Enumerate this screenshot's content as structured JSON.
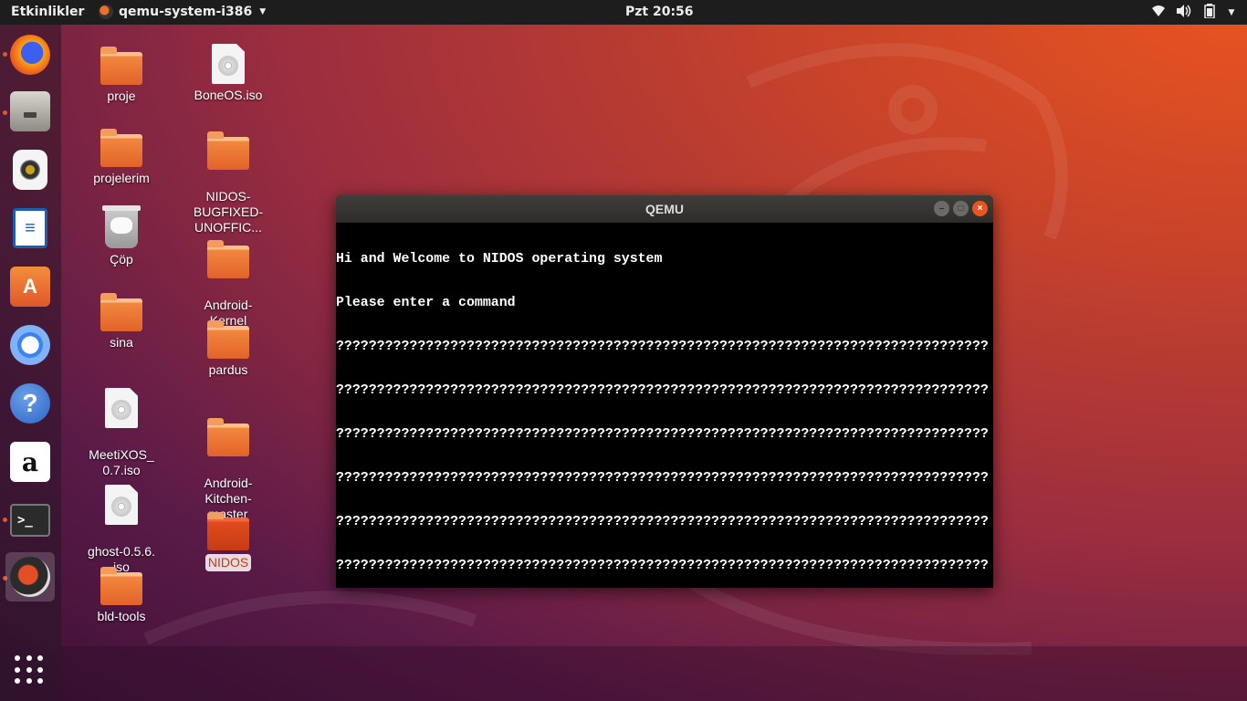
{
  "topbar": {
    "activities": "Etkinlikler",
    "app_name": "qemu-system-i386",
    "clock": "Pzt 20:56",
    "tray_icons": [
      "wifi-icon",
      "volume-icon",
      "battery-icon",
      "chevron-down-icon"
    ]
  },
  "dock": {
    "items": [
      "firefox",
      "files",
      "rhythmbox",
      "libreoffice-writer",
      "ubuntu-software",
      "chromium",
      "help",
      "amazon",
      "terminal",
      "qemu"
    ],
    "running": [
      "firefox",
      "files",
      "terminal",
      "qemu"
    ],
    "active": "qemu",
    "show_apps": "show-applications-icon"
  },
  "desktop": {
    "col1": [
      {
        "label": "proje",
        "type": "folder"
      },
      {
        "label": "projelerim",
        "type": "folder"
      },
      {
        "label": "Çöp",
        "type": "trash"
      },
      {
        "label": "sina",
        "type": "folder"
      },
      {
        "label": "MeetiXOS_\n0.7.iso",
        "type": "iso"
      },
      {
        "label": "ghost-0.5.6.\niso",
        "type": "iso"
      },
      {
        "label": "bld-tools",
        "type": "folder"
      }
    ],
    "col2": [
      {
        "label": "BoneOS.iso",
        "type": "iso"
      },
      {
        "label": "NIDOS-\nBUGFIXED-\nUNOFFIC...",
        "type": "folder"
      },
      {
        "label": "Android-\nKernel",
        "type": "folder"
      },
      {
        "label": "pardus",
        "type": "folder"
      },
      {
        "label": "Android-\nKitchen-\nmaster",
        "type": "folder"
      },
      {
        "label": "NIDOS",
        "type": "folder",
        "selected": true
      }
    ]
  },
  "qemu": {
    "title": "QEMU",
    "screen_lines": [
      "Hi and Welcome to NIDOS operating system",
      "Please enter a command",
      "????????????????????????????????????????????????????????????????????????????????",
      "????????????????????????????????????????????????????????????????????????????????",
      "????????????????????????????????????????????????????????????????????????????????",
      "????????????????????????????????????????????????????????????????????????????????",
      "????????????????????????????????????????????????????????????????????????????????",
      "????????????????????????????????????????????????????????????????????????????????",
      "?????????????????????????????????????????????????????????????????"
    ]
  },
  "colors": {
    "accent": "#e95420",
    "topbar": "#1d1d1d",
    "terminal_bg": "#000000",
    "terminal_fg": "#ffffff"
  }
}
